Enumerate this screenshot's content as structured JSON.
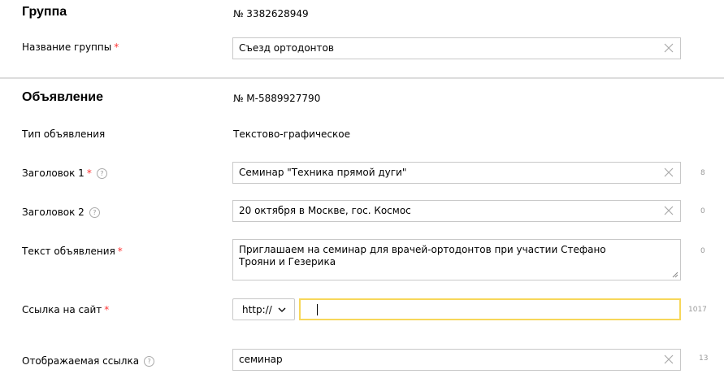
{
  "group": {
    "title": "Группа",
    "number": "№ 3382628949",
    "name_label": "Название группы",
    "name_value": "Съезд ортодонтов"
  },
  "ad": {
    "title": "Объявление",
    "number": "№ M-5889927790",
    "type_label": "Тип объявления",
    "type_value": "Текстово-графическое",
    "headline1_label": "Заголовок 1",
    "headline1_value": "Семинар \"Техника прямой дуги\"",
    "headline1_counter": "8",
    "headline2_label": "Заголовок 2",
    "headline2_value": "20 октября в Москве, гос. Космос",
    "headline2_counter": "0",
    "text_label": "Текст объявления",
    "text_value": "Приглашаем на семинар для врачей-ортодонтов при участии Стефано Трояни и Гезерика",
    "text_counter": "0",
    "link_label": "Ссылка на сайт",
    "link_protocol": "http://",
    "link_value": "",
    "link_counter": "1017",
    "display_link_label": "Отображаемая ссылка",
    "display_link_value": "семинар",
    "display_link_counter": "13"
  },
  "required_mark": "*",
  "help_mark": "?",
  "colors": {
    "required": "#ff3333",
    "focus_border": "#f7d75a",
    "border": "#c8c8c8",
    "counter": "#999999"
  }
}
